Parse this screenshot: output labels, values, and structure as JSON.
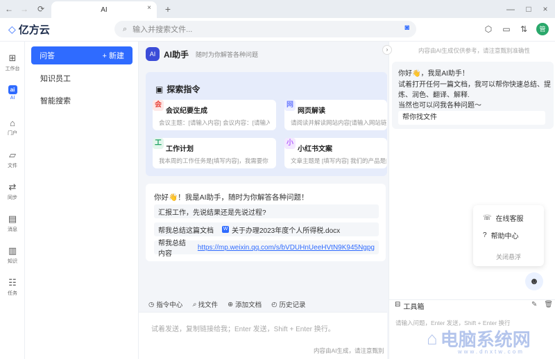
{
  "browser": {
    "tab_title": "AI",
    "new_tab": "+",
    "close_tab": "×",
    "back": "←",
    "forward": "→",
    "reload": "⟳",
    "window_controls": [
      "—",
      "□",
      "×"
    ]
  },
  "header": {
    "logo": "亿方云",
    "search_placeholder": "输入并搜索文件...",
    "avatar_text": "管"
  },
  "rail": {
    "items": [
      {
        "label": "工作台",
        "icon": "grid-icon"
      },
      {
        "label": "AI",
        "icon": "ai-icon"
      },
      {
        "label": "门户",
        "icon": "home-icon"
      },
      {
        "label": "文件",
        "icon": "folder-icon"
      },
      {
        "label": "同步",
        "icon": "sync-icon"
      },
      {
        "label": "消息",
        "icon": "message-icon"
      },
      {
        "label": "知识",
        "icon": "book-icon"
      },
      {
        "label": "任务",
        "icon": "task-icon"
      }
    ]
  },
  "sidebar": {
    "active_label": "问答",
    "new_label": "+ 新建",
    "items": [
      "知识员工",
      "智能搜索"
    ]
  },
  "main": {
    "ai_badge": "AI",
    "ai_name": "AI助手",
    "ai_subtitle": "随时为你解答各种问题",
    "explore_title": "探索指令",
    "cards": [
      {
        "badge": "会",
        "title": "会议纪要生成",
        "desc": "会议主题：[请输入内容] 会议内容：[请输入",
        "color": "#e8453c"
      },
      {
        "badge": "网",
        "title": "网页解读",
        "desc": "请阅读并解读网站内容[请输入网站链接",
        "color": "#6b7cff"
      },
      {
        "badge": "工",
        "title": "工作计划",
        "desc": "我本周的工作任务是[填写内容]，我需要你",
        "color": "#21a366"
      },
      {
        "badge": "小",
        "title": "小红书文案",
        "desc": "文章主题是 [填写内容] 我们的产品是[",
        "color": "#b86bff"
      }
    ],
    "greeting": "你好👋！我是AI助手，随时为你解答各种问题！",
    "suggestions": [
      {
        "text": "汇报工作，先说结果还是先说过程?"
      },
      {
        "text": "帮我总结这篇文档",
        "file": "关于办理2023年度个人所得税.docx"
      },
      {
        "text": "帮我总结内容",
        "link": "https://mp.weixin.qq.com/s/bVDUHnUeeHVtN9K945Ngpg"
      }
    ],
    "toolbar": [
      "指令中心",
      "找文件",
      "添加文档",
      "历史记录"
    ],
    "input_placeholder": "试着发送，复制链接给我；Enter 发送，Shift + Enter 换行。",
    "footer_note": "内容由AI生成，请注意甄别"
  },
  "right": {
    "note": "内容由AI生成仅供参考，请注意甄别准确性",
    "lines": [
      "你好👋，我是AI助手！",
      "试着打开任何一篇文档，我可以帮你快速总结、提",
      "炼、润色、翻译、解释.",
      "当然也可以问我各种问题～"
    ],
    "find_file": "帮你找文件",
    "float_menu": [
      "在线客服",
      "帮助中心"
    ],
    "float_close": "关闭悬浮",
    "toolbox_title": "工具箱",
    "toolbox_placeholder": "请输入问题，Enter 发送，Shift + Enter 换行"
  },
  "watermark": {
    "text": "电脑系统网",
    "url": "www.dnxtw.com"
  }
}
